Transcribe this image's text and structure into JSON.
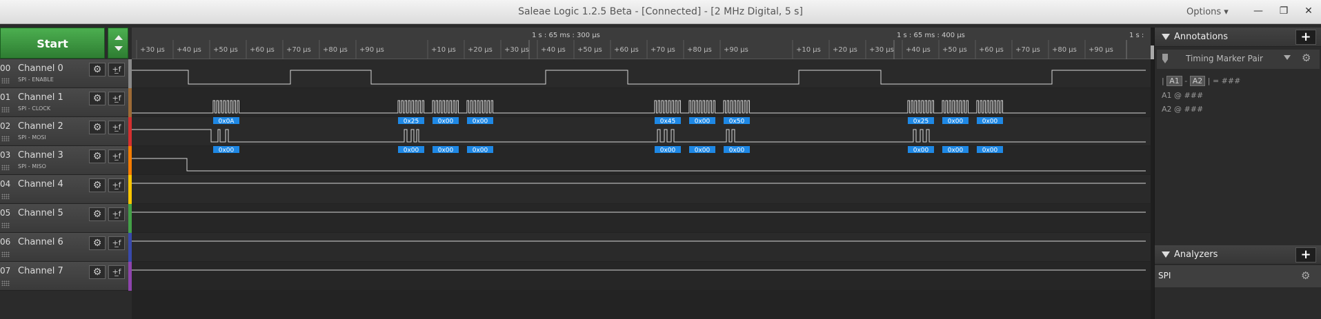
{
  "window": {
    "title": "Saleae Logic 1.2.5 Beta - [Connected] - [2 MHz Digital, 5 s]",
    "options_label": "Options ▾",
    "minimize_glyph": "—",
    "maximize_glyph": "❐",
    "close_glyph": "✕"
  },
  "toolbar": {
    "start_label": "Start"
  },
  "timeline": {
    "major_labels": [
      "1 s : 65 ms : 300 μs",
      "1 s : 65 ms : 400 μs",
      "1 s :"
    ],
    "minor_labels": [
      "+30 μs",
      "+40 μs",
      "+50 μs",
      "+60 μs",
      "+70 μs",
      "+80 μs",
      "+90 μs",
      "+10 μs",
      "+20 μs",
      "+30 μs",
      "+40 μs",
      "+50 μs",
      "+60 μs",
      "+70 μs",
      "+80 μs",
      "+90 μs",
      "+10 μs",
      "+20 μs",
      "+30 μs",
      "+40 μs",
      "+50 μs",
      "+60 μs",
      "+70 μs",
      "+80 μs",
      "+90 μs"
    ]
  },
  "channels": [
    {
      "num": "00",
      "name": "Channel 0",
      "sub": "SPI - ENABLE",
      "color": "#8a8a8a"
    },
    {
      "num": "01",
      "name": "Channel 1",
      "sub": "SPI - CLOCK",
      "color": "#9c6a36"
    },
    {
      "num": "02",
      "name": "Channel 2",
      "sub": "SPI - MOSI",
      "color": "#d32f2f"
    },
    {
      "num": "03",
      "name": "Channel 3",
      "sub": "SPI - MISO",
      "color": "#f57c00"
    },
    {
      "num": "04",
      "name": "Channel 4",
      "sub": "",
      "color": "#f9c500"
    },
    {
      "num": "05",
      "name": "Channel 5",
      "sub": "",
      "color": "#43a047"
    },
    {
      "num": "06",
      "name": "Channel 6",
      "sub": "",
      "color": "#3949ab"
    },
    {
      "num": "07",
      "name": "Channel 7",
      "sub": "",
      "color": "#8e44ad"
    }
  ],
  "channel_icons": {
    "gear": "gear-icon",
    "trigger": "trigger-icon",
    "gear_glyph": "⚙",
    "trigger_glyph": "+̲f"
  },
  "decoded": {
    "clock": [
      "0x0A",
      "0x25",
      "0x00",
      "0x00",
      "0x45",
      "0x00",
      "0x50",
      "0x25",
      "0x00",
      "0x00"
    ],
    "mosi": [
      "0x00",
      "0x00",
      "0x00",
      "0x00",
      "0x00",
      "0x00",
      "0x00",
      "0x00",
      "0x00",
      "0x00"
    ],
    "label_color": "#1e88e5"
  },
  "annotations": {
    "title": "Annotations",
    "add_glyph": "+",
    "marker_name": "Timing Marker Pair",
    "a1": "A1",
    "a2": "A2",
    "sep1": "|",
    "minus": "-",
    "sep2": "| = ###",
    "a1_line": "@ ###",
    "a2_line": "@ ###"
  },
  "analyzers": {
    "title": "Analyzers",
    "add_glyph": "+",
    "items": [
      {
        "name": "SPI"
      }
    ]
  },
  "colors": {
    "accent_green": "#43a047",
    "background": "#232323",
    "trace": "#d8d8d8"
  }
}
